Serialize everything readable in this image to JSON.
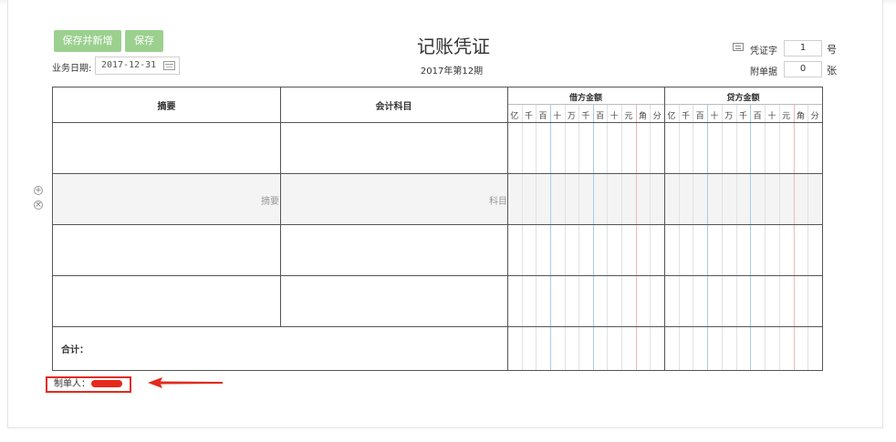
{
  "toolbar": {
    "save_new_label": "保存并新增",
    "save_label": "保存"
  },
  "business_date": {
    "label": "业务日期:",
    "value": "2017-12-31"
  },
  "voucher": {
    "title": "记账凭证",
    "period": "2017年第12期"
  },
  "voucher_no": {
    "label": "凭证字",
    "value": "1",
    "unit": "号"
  },
  "attachments": {
    "label": "附单据",
    "value": "0",
    "unit": "张"
  },
  "table": {
    "col_summary": "摘要",
    "col_account": "会计科目",
    "col_debit": "借方金额",
    "col_credit": "贷方金额",
    "digit_units": [
      "亿",
      "千",
      "百",
      "十",
      "万",
      "千",
      "百",
      "十",
      "元",
      "角",
      "分"
    ],
    "summary_placeholder": "摘要",
    "account_placeholder": "科目",
    "total_label": "合计："
  },
  "row_actions": {
    "add_icon": "plus-circle-icon",
    "remove_icon": "x-circle-icon"
  },
  "maker": {
    "label": "制单人："
  },
  "colors": {
    "button_green": "#9bd08f",
    "highlight_red": "#e32a1c"
  }
}
